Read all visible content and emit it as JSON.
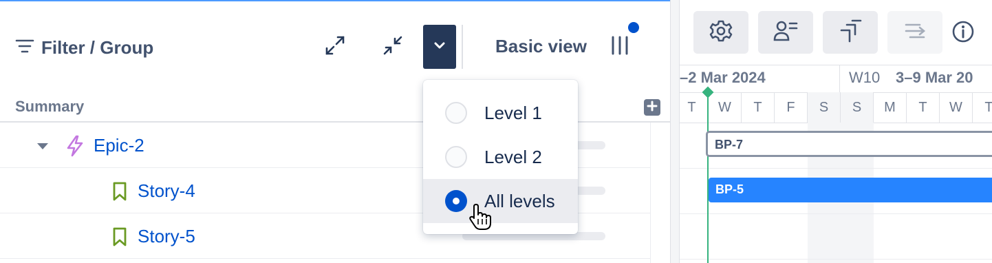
{
  "toolbar": {
    "filter_label": "Filter / Group",
    "view_label": "Basic view"
  },
  "list": {
    "summary_header": "Summary",
    "rows": [
      {
        "key": "Epic-2",
        "type": "epic"
      },
      {
        "key": "Story-4",
        "type": "story"
      },
      {
        "key": "Story-5",
        "type": "story"
      }
    ]
  },
  "level_menu": {
    "options": [
      {
        "label": "Level 1",
        "selected": false
      },
      {
        "label": "Level 2",
        "selected": false
      },
      {
        "label": "All levels",
        "selected": true
      }
    ]
  },
  "timeline": {
    "range_prev": "–2 Mar 2024",
    "week_label": "W10",
    "range_current": "3–9 Mar 20",
    "days": [
      "T",
      "W",
      "T",
      "F",
      "S",
      "S",
      "M",
      "T",
      "W",
      "T"
    ],
    "bars": [
      {
        "label": "BP-7"
      },
      {
        "label": "BP-5"
      }
    ]
  },
  "colors": {
    "accent": "#0052cc",
    "dropdown_bg": "#253858",
    "today": "#36b37e",
    "bar_blue": "#2684ff",
    "epic_icon": "#c377e0",
    "story_icon": "#6a9a23"
  },
  "icons": [
    "filter-icon",
    "expand-icon",
    "collapse-icon",
    "chevron-down-icon",
    "columns-icon",
    "plus-icon",
    "caret-down-icon",
    "lightning-icon",
    "bookmark-icon",
    "gear-icon",
    "assignee-icon",
    "dependency-icon",
    "sort-icon",
    "info-icon",
    "hand-cursor-icon"
  ]
}
